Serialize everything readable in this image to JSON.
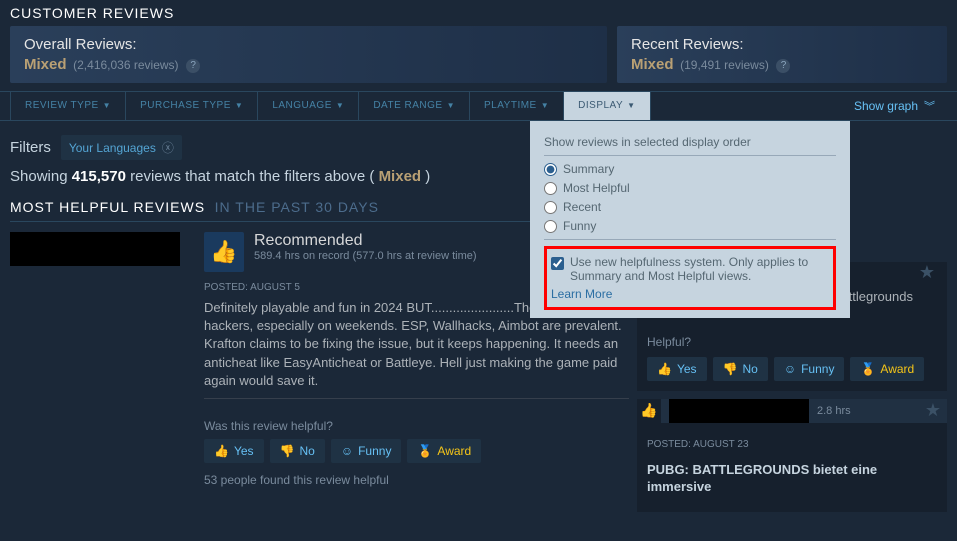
{
  "header": {
    "title": "CUSTOMER REVIEWS"
  },
  "overall": {
    "label": "Overall Reviews:",
    "rating": "Mixed",
    "count": "(2,416,036 reviews)"
  },
  "recent": {
    "label": "Recent Reviews:",
    "rating": "Mixed",
    "count": "(19,491 reviews)"
  },
  "filters": {
    "review_type": "REVIEW TYPE",
    "purchase_type": "PURCHASE TYPE",
    "language": "LANGUAGE",
    "date_range": "DATE RANGE",
    "playtime": "PLAYTIME",
    "display": "DISPLAY",
    "show_graph": "Show graph"
  },
  "dropdown": {
    "title": "Show reviews in selected display order",
    "opt_summary": "Summary",
    "opt_helpful": "Most Helpful",
    "opt_recent": "Recent",
    "opt_funny": "Funny",
    "checkbox": "Use new helpfulness system. Only applies to Summary and Most Helpful views.",
    "learn_more": "Learn More"
  },
  "filters_row": {
    "label": "Filters",
    "chip": "Your Languages"
  },
  "showing": {
    "pre": "Showing ",
    "count": "415,570",
    "mid": " reviews that match the filters above ( ",
    "rating": "Mixed",
    "post": " )"
  },
  "left": {
    "title": "MOST HELPFUL REVIEWS",
    "subtitle": "IN THE PAST 30 DAYS",
    "review1": {
      "recommended": "Recommended",
      "hours": "589.4 hrs on record (577.0 hrs at review time)",
      "posted": "POSTED: AUGUST 5",
      "text": "Definitely playable and fun in 2024 BUT.......................There are so many hackers, especially on weekends. ESP, Wallhacks, Aimbot are prevalent. Krafton claims to be fixing the issue, but it keeps happening. It needs an anticheat like EasyAnticheat or Battleye. Hell just making the game paid again would save it.",
      "helpful_q": "Was this review helpful?",
      "found": "53 people found this review helpful"
    }
  },
  "right": {
    "review1": {
      "text": "player unknowns battle grounds battlegrounds sucks",
      "helpful_q": "Helpful?"
    },
    "review2": {
      "hours": "2.8 hrs",
      "posted": "POSTED: AUGUST 23",
      "text": "PUBG: BATTLEGROUNDS bietet eine immersive"
    }
  },
  "votes": {
    "yes": "Yes",
    "no": "No",
    "funny": "Funny",
    "award": "Award"
  }
}
